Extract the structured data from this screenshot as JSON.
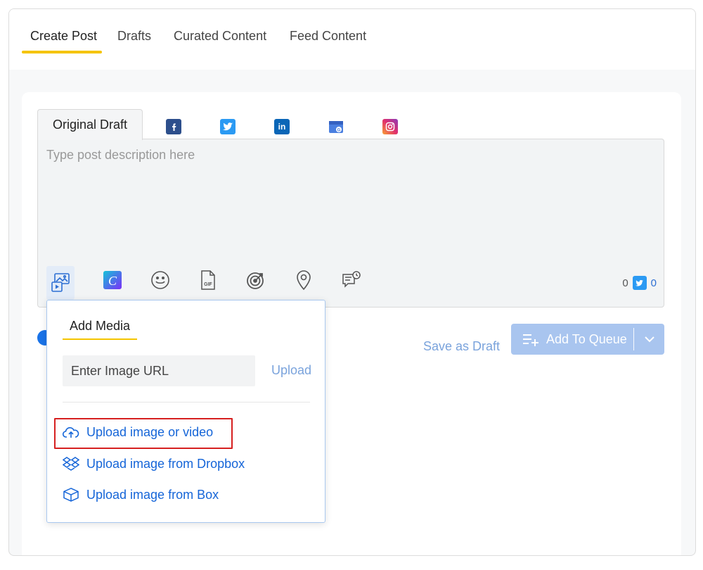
{
  "top_tabs": [
    "Create Post",
    "Drafts",
    "Curated Content",
    "Feed Content"
  ],
  "editor": {
    "draft_tab": "Original Draft",
    "networks": [
      "facebook-icon",
      "twitter-icon",
      "linkedin-icon",
      "google-business-icon",
      "instagram-icon"
    ],
    "placeholder": "Type post description here",
    "tools": [
      "add-media-icon",
      "canva-icon",
      "emoji-icon",
      "gif-icon",
      "target-icon",
      "location-icon",
      "comment-schedule-icon"
    ],
    "counter_general": "0",
    "counter_twitter": "0"
  },
  "actions": {
    "save_draft": "Save as Draft",
    "add_to_queue": "Add To Queue"
  },
  "media_popup": {
    "title": "Add Media",
    "url_placeholder": "Enter Image URL",
    "url_upload": "Upload",
    "options": [
      "Upload image or video",
      "Upload image from Dropbox",
      "Upload image from Box"
    ]
  },
  "colors": {
    "accent_yellow": "#f5c400",
    "link_blue": "#1565d8",
    "button_blue": "#a9c5ef",
    "highlight_red": "#d62020"
  }
}
